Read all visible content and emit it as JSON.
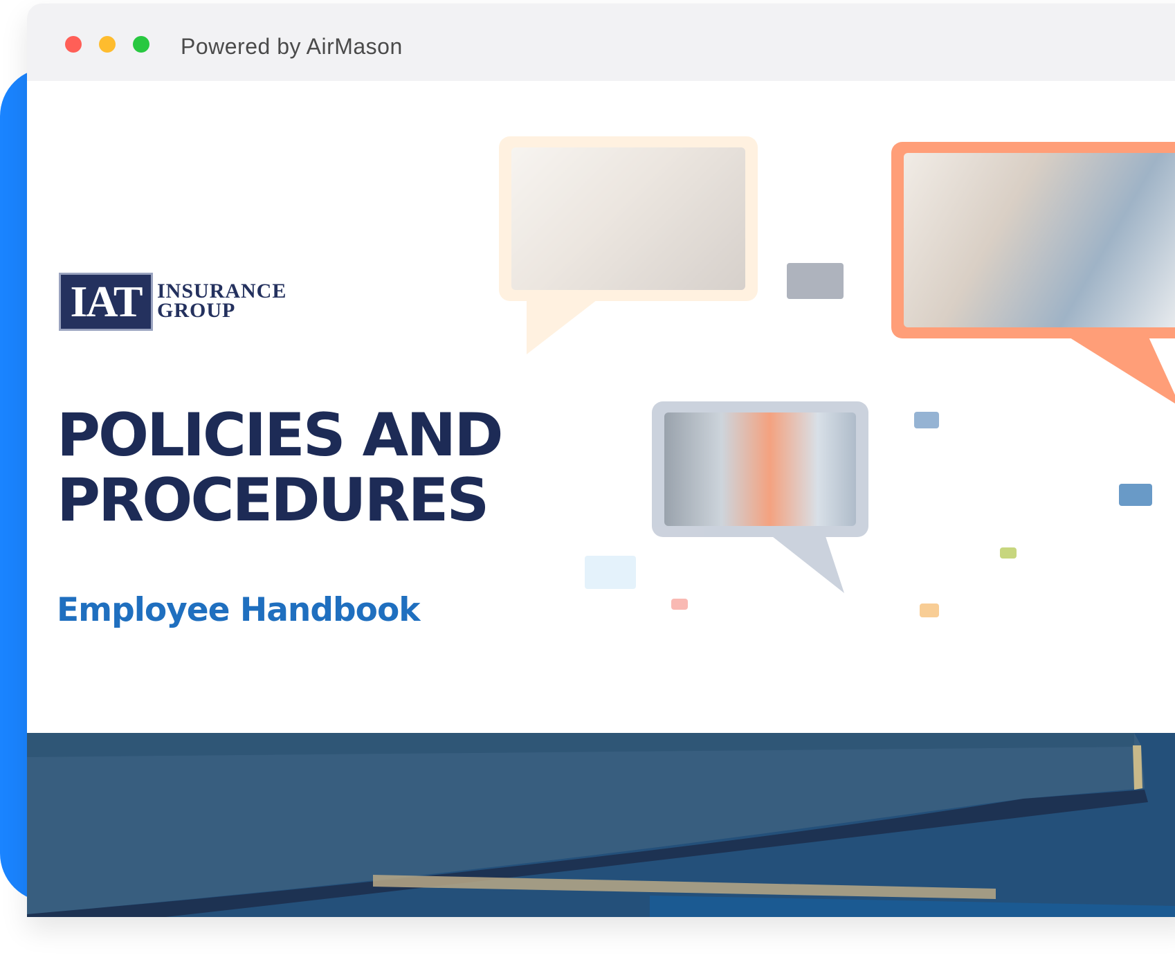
{
  "window": {
    "title": "Powered by AirMason",
    "controls": {
      "close_color": "#ff5f57",
      "minimize_color": "#febc2e",
      "maximize_color": "#28c840"
    }
  },
  "logo": {
    "mark": "IAT",
    "line1": "INSURANCE",
    "line2": "GROUP"
  },
  "cover": {
    "title_line1": "POLICIES AND",
    "title_line2": "PROCEDURES",
    "subtitle": "Employee Handbook"
  },
  "colors": {
    "accent_blue": "#1a84ff",
    "title_navy": "#1d2b56",
    "subtitle_blue": "#1f6fbf",
    "bubble_orange": "#ff9e78"
  }
}
